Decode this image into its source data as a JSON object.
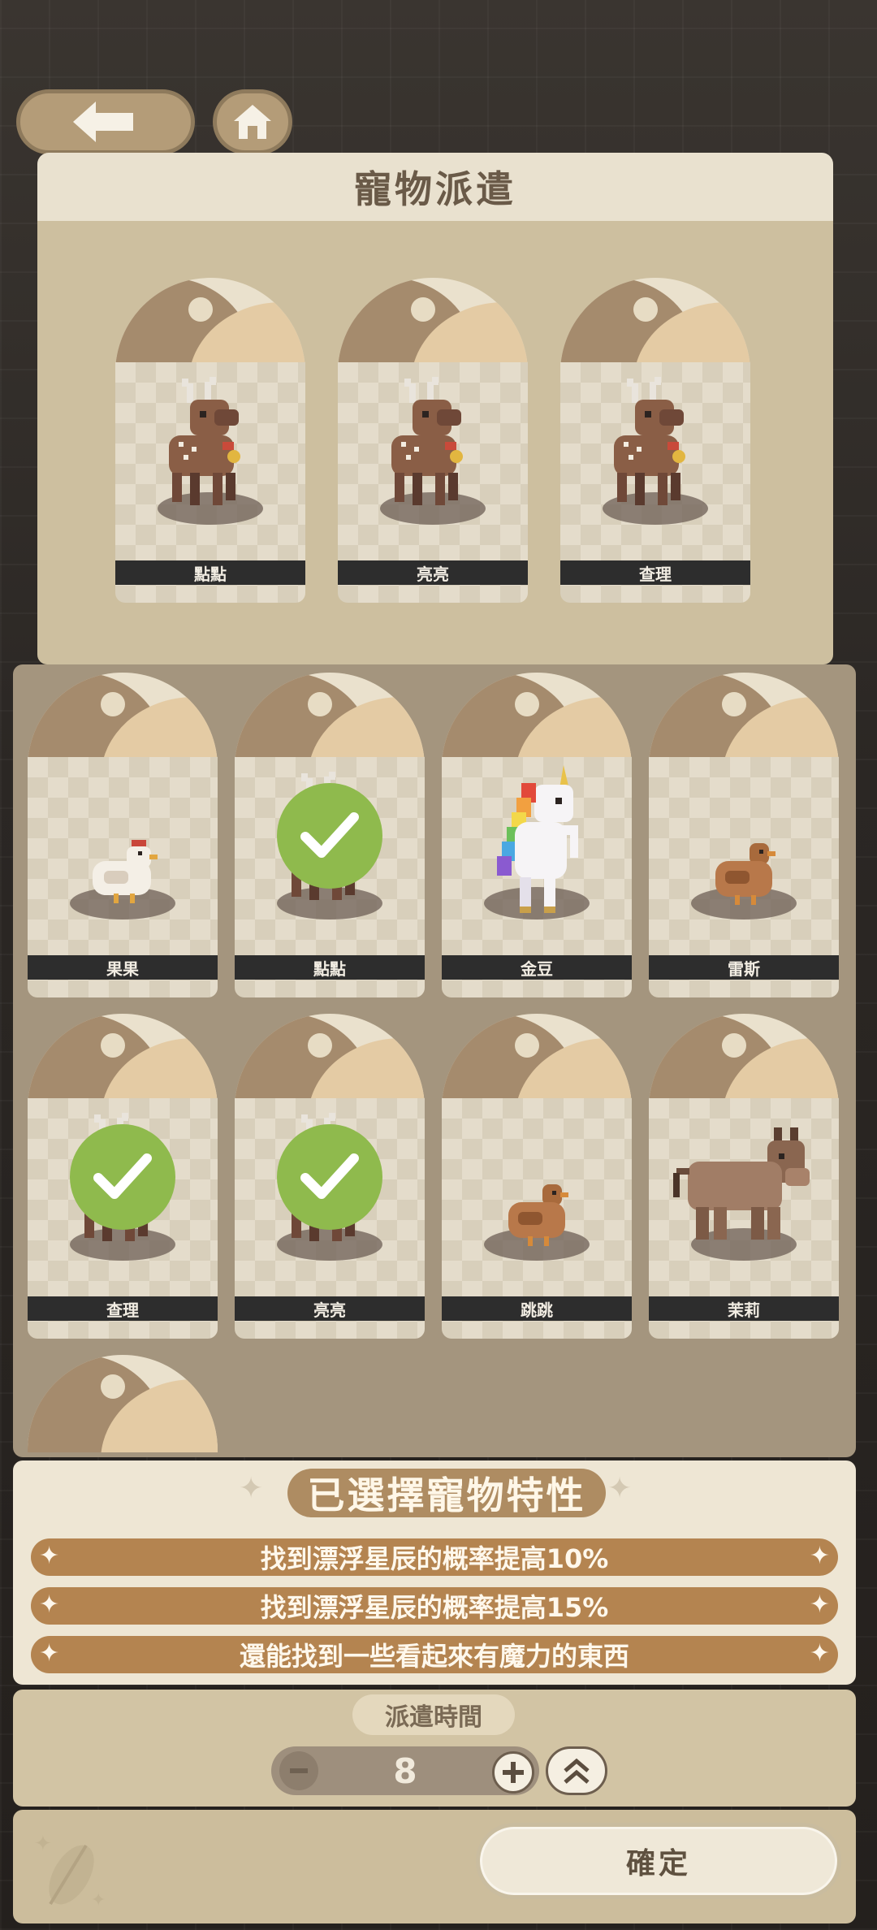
{
  "title": "寵物派遣",
  "selected_pets": [
    {
      "name": "點點",
      "sprite": "deer"
    },
    {
      "name": "亮亮",
      "sprite": "deer"
    },
    {
      "name": "查理",
      "sprite": "deer"
    }
  ],
  "roster": [
    {
      "name": "果果",
      "sprite": "chicken-white",
      "selected": false
    },
    {
      "name": "點點",
      "sprite": "deer",
      "selected": true
    },
    {
      "name": "金豆",
      "sprite": "unicorn",
      "selected": false
    },
    {
      "name": "雷斯",
      "sprite": "chicken-brown",
      "selected": false
    },
    {
      "name": "查理",
      "sprite": "deer",
      "selected": true
    },
    {
      "name": "亮亮",
      "sprite": "deer",
      "selected": true
    },
    {
      "name": "跳跳",
      "sprite": "chicken-brown",
      "selected": false
    },
    {
      "name": "茉莉",
      "sprite": "donkey",
      "selected": false
    }
  ],
  "traits": {
    "heading": "已選擇寵物特性",
    "items": [
      "找到漂浮星辰的概率提高10%",
      "找到漂浮星辰的概率提高15%",
      "還能找到一些看起來有魔力的東西"
    ]
  },
  "dispatch_time": {
    "label": "派遣時間",
    "value": "8"
  },
  "confirm_label": "確定",
  "icons": {
    "back": "arrow-left-icon",
    "home": "home-icon",
    "check": "checkmark-icon",
    "minus": "minus-icon",
    "plus": "plus-icon",
    "max": "double-chevron-up-icon",
    "feather": "feather-icon"
  },
  "colors": {
    "check_green": "#8fba4d",
    "trait_bar": "#b48450",
    "panel_cream": "#eee6d4"
  }
}
